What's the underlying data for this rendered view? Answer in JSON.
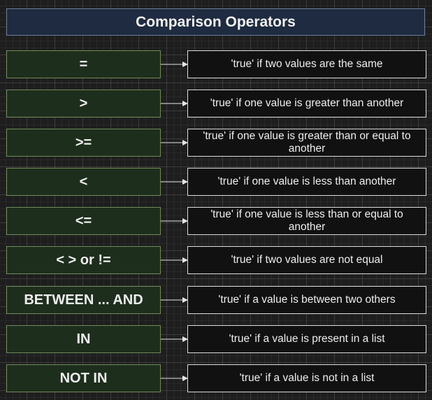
{
  "title": "Comparison Operators",
  "operators": [
    {
      "symbol": "=",
      "description": "'true' if two values are the same"
    },
    {
      "symbol": ">",
      "description": "'true' if one value is greater than another"
    },
    {
      "symbol": ">=",
      "description": "'true' if one value is greater than or equal to another"
    },
    {
      "symbol": "<",
      "description": "'true' if one value is less than another"
    },
    {
      "symbol": "<=",
      "description": "'true' if one value is less than or equal to another"
    },
    {
      "symbol": "< > or !=",
      "description": "'true' if two values are not equal"
    },
    {
      "symbol": "BETWEEN ... AND",
      "description": "'true' if a value is between two others"
    },
    {
      "symbol": "IN",
      "description": "'true' if a value is present in a list"
    },
    {
      "symbol": "NOT IN",
      "description": "'true' if a value is not in a list"
    }
  ],
  "colors": {
    "operator_fill": "#1e2e1d",
    "operator_border": "#6e8c56",
    "description_fill": "#111111",
    "description_border": "#dcdcdc",
    "title_fill": "#1e2b40",
    "arrow": "#e6e6e6"
  }
}
